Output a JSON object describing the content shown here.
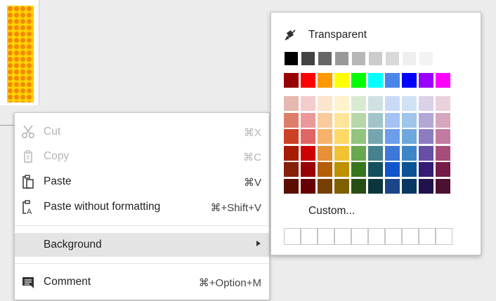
{
  "menu": {
    "items": [
      {
        "label": "Cut",
        "shortcut": "⌘X",
        "icon": "scissors-icon",
        "disabled": true
      },
      {
        "label": "Copy",
        "shortcut": "⌘C",
        "icon": "copy-icon",
        "disabled": true
      },
      {
        "label": "Paste",
        "shortcut": "⌘V",
        "icon": "clipboard-icon",
        "disabled": false
      },
      {
        "label": "Paste without formatting",
        "shortcut": "⌘+Shift+V",
        "icon": "clipboard-text-icon",
        "disabled": false
      }
    ],
    "background": {
      "label": "Background",
      "has_submenu": true
    },
    "comment": {
      "label": "Comment",
      "shortcut": "⌘+Option+M",
      "icon": "comment-icon"
    }
  },
  "palette": {
    "transparent_label": "Transparent",
    "custom_label": "Custom...",
    "custom_slots": 10,
    "gray_row": [
      "#000000",
      "#434343",
      "#666666",
      "#999999",
      "#b7b7b7",
      "#cccccc",
      "#d9d9d9",
      "#efefef",
      "#f3f3f3",
      "#ffffff"
    ],
    "bright_row": [
      "#980000",
      "#ff0000",
      "#ff9900",
      "#ffff00",
      "#00ff00",
      "#00ffff",
      "#4a86e8",
      "#0000ff",
      "#9900ff",
      "#ff00ff"
    ],
    "shade_rows": [
      [
        "#e6b8af",
        "#f4cccc",
        "#fce5cd",
        "#fff2cc",
        "#d9ead3",
        "#d0e0e3",
        "#c9daf8",
        "#cfe2f3",
        "#d9d2e9",
        "#ead1dc"
      ],
      [
        "#dd7e6b",
        "#ea9999",
        "#f9cb9c",
        "#ffe599",
        "#b6d7a8",
        "#a2c4c9",
        "#a4c2f4",
        "#9fc5e8",
        "#b4a7d6",
        "#d5a6bd"
      ],
      [
        "#cc4125",
        "#e06666",
        "#f6b26b",
        "#ffd966",
        "#93c47d",
        "#76a5af",
        "#6d9eeb",
        "#6fa8dc",
        "#8e7cc3",
        "#c27ba0"
      ],
      [
        "#a61c00",
        "#cc0000",
        "#e69138",
        "#f1c232",
        "#6aa84f",
        "#45818e",
        "#3c78d8",
        "#3d85c6",
        "#674ea7",
        "#a64d79"
      ],
      [
        "#85200c",
        "#990000",
        "#b45f06",
        "#bf9000",
        "#38761d",
        "#134f5c",
        "#1155cc",
        "#0b5394",
        "#351c75",
        "#741b47"
      ],
      [
        "#5b0f00",
        "#660000",
        "#783f04",
        "#7f6000",
        "#274e13",
        "#0c343d",
        "#1c4587",
        "#073763",
        "#20124d",
        "#4c1130"
      ]
    ]
  }
}
